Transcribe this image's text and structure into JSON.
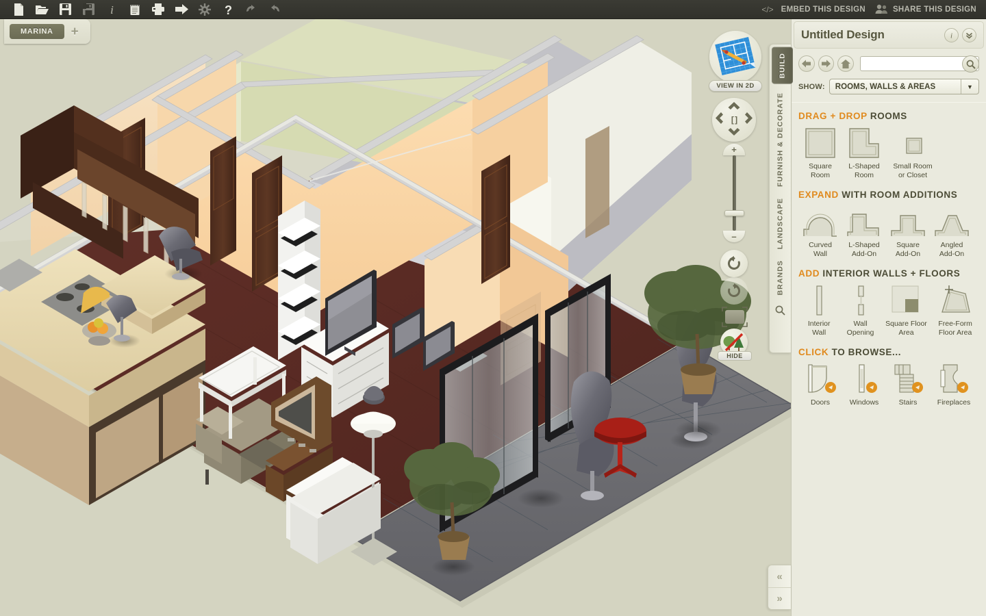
{
  "toolbar": {
    "icons": [
      {
        "name": "new-file-icon",
        "label": "New"
      },
      {
        "name": "open-folder-icon",
        "label": "Open"
      },
      {
        "name": "save-icon",
        "label": "Save"
      },
      {
        "name": "save-as-icon",
        "label": "Save As"
      },
      {
        "name": "info-icon",
        "label": "Info"
      },
      {
        "name": "notes-icon",
        "label": "Notes"
      },
      {
        "name": "print-icon",
        "label": "Print"
      },
      {
        "name": "export-icon",
        "label": "Export"
      },
      {
        "name": "settings-gear-icon",
        "label": "Settings"
      },
      {
        "name": "help-icon",
        "label": "Help"
      },
      {
        "name": "undo-icon",
        "label": "Undo"
      },
      {
        "name": "redo-icon",
        "label": "Redo"
      }
    ],
    "embed_label": "EMBED THIS DESIGN",
    "share_label": "SHARE THIS DESIGN"
  },
  "project_tabs": {
    "active": "MARINA",
    "add_label": "+"
  },
  "viewport": {
    "view_2d_label": "VIEW IN 2D",
    "hide_label": "HIDE",
    "nav_center_label": "[ ]"
  },
  "rail": {
    "tabs": [
      {
        "label": "BUILD",
        "active": true
      },
      {
        "label": "FURNISH & DECORATE",
        "active": false
      },
      {
        "label": "LANDSCAPE",
        "active": false
      },
      {
        "label": "BRANDS",
        "active": false
      }
    ],
    "search_icon": "search-icon"
  },
  "panel": {
    "title": "Untitled Design",
    "search": {
      "value": "",
      "placeholder": ""
    },
    "show_label": "SHOW:",
    "show_value": "ROOMS, WALLS & AREAS",
    "sections": [
      {
        "id": "drag-drop-rooms",
        "highlight": "DRAG + DROP",
        "rest": " ROOMS",
        "items": [
          {
            "icon": "square-room-icon",
            "label": "Square\nRoom"
          },
          {
            "icon": "l-shaped-room-icon",
            "label": "L-Shaped\nRoom"
          },
          {
            "icon": "small-room-closet-icon",
            "label": "Small Room\nor Closet"
          }
        ]
      },
      {
        "id": "expand-room-additions",
        "highlight": "EXPAND",
        "rest": " WITH ROOM ADDITIONS",
        "items": [
          {
            "icon": "curved-wall-icon",
            "label": "Curved\nWall"
          },
          {
            "icon": "l-shaped-addon-icon",
            "label": "L-Shaped\nAdd-On"
          },
          {
            "icon": "square-addon-icon",
            "label": "Square\nAdd-On"
          },
          {
            "icon": "angled-addon-icon",
            "label": "Angled\nAdd-On"
          }
        ]
      },
      {
        "id": "add-interior-walls-floors",
        "highlight": "ADD",
        "rest": " INTERIOR WALLS + FLOORS",
        "items": [
          {
            "icon": "interior-wall-icon",
            "label": "Interior\nWall"
          },
          {
            "icon": "wall-opening-icon",
            "label": "Wall\nOpening"
          },
          {
            "icon": "square-floor-area-icon",
            "label": "Square Floor\nArea"
          },
          {
            "icon": "free-form-floor-area-icon",
            "label": "Free-Form\nFloor Area"
          }
        ]
      },
      {
        "id": "click-to-browse",
        "highlight": "CLICK",
        "rest": " TO BROWSE...",
        "items": [
          {
            "icon": "doors-icon",
            "label": "Doors"
          },
          {
            "icon": "windows-icon",
            "label": "Windows"
          },
          {
            "icon": "stairs-icon",
            "label": "Stairs"
          },
          {
            "icon": "fireplaces-icon",
            "label": "Fireplaces"
          }
        ]
      }
    ]
  },
  "collapse": {
    "prev_label": "«",
    "next_label": "»"
  },
  "colors": {
    "accent": "#e08a1e",
    "panel_bg": "#eaeade",
    "toolbar_bg": "#34342d",
    "canvas_bg": "#d4d4c1",
    "text_dark": "#4c4c36",
    "tab_active": "#6b6b54"
  }
}
